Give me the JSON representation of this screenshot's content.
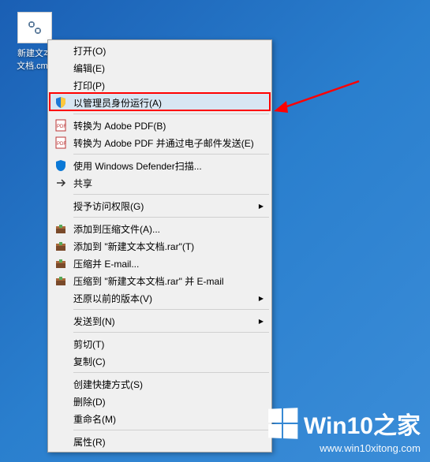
{
  "desktop": {
    "file_label": "新建文本文档.cmd"
  },
  "menu": {
    "open": "打开(O)",
    "edit": "编辑(E)",
    "print": "打印(P)",
    "run_as_admin": "以管理员身份运行(A)",
    "convert_adobe": "转换为 Adobe PDF(B)",
    "convert_adobe_email": "转换为 Adobe PDF 并通过电子邮件发送(E)",
    "defender_scan": "使用 Windows Defender扫描...",
    "share": "共享",
    "grant_access": "授予访问权限(G)",
    "add_to_archive": "添加到压缩文件(A)...",
    "add_to_rar": "添加到 \"新建文本文档.rar\"(T)",
    "compress_email": "压缩并 E-mail...",
    "compress_rar_email": "压缩到 \"新建文本文档.rar\" 并 E-mail",
    "restore_previous": "还原以前的版本(V)",
    "send_to": "发送到(N)",
    "cut": "剪切(T)",
    "copy": "复制(C)",
    "create_shortcut": "创建快捷方式(S)",
    "delete": "删除(D)",
    "rename": "重命名(M)",
    "properties": "属性(R)"
  },
  "watermark": {
    "brand": "Win10之家",
    "url": "www.win10xitong.com"
  },
  "annotation": {
    "highlight_target": "run_as_admin"
  }
}
